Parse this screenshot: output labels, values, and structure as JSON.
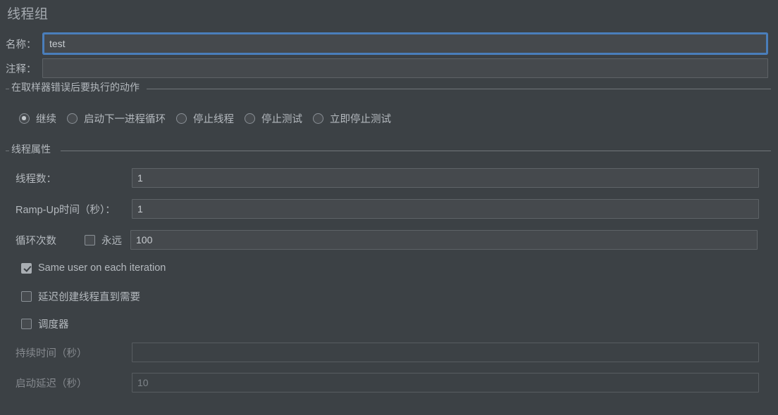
{
  "panel": {
    "title": "线程组"
  },
  "name_field": {
    "label": "名称：",
    "value": "test",
    "placeholder": ""
  },
  "comment_field": {
    "label": "注释：",
    "value": "",
    "placeholder": ""
  },
  "error_action_group": {
    "title": "在取样器错误后要执行的动作",
    "selected": "继续",
    "options": [
      {
        "label": "继续",
        "checked": true
      },
      {
        "label": "启动下一进程循环",
        "checked": false
      },
      {
        "label": "停止线程",
        "checked": false
      },
      {
        "label": "停止测试",
        "checked": false
      },
      {
        "label": "立即停止测试",
        "checked": false
      }
    ]
  },
  "thread_properties": {
    "title": "线程属性",
    "num_threads": {
      "label": "线程数：",
      "value": "1"
    },
    "ramp_up": {
      "label": "Ramp-Up时间（秒）：",
      "value": "1"
    },
    "loop_count": {
      "label": "循环次数",
      "forever_label": "永远",
      "forever_checked": false,
      "value": "100"
    },
    "same_user": {
      "label": "Same user on each iteration",
      "checked": true
    },
    "delay_thread_creation": {
      "label": "延迟创建线程直到需要",
      "checked": false
    },
    "scheduler": {
      "label": "调度器",
      "checked": false
    },
    "duration": {
      "label": "持续时间（秒）",
      "value": "",
      "enabled": false
    },
    "startup_delay": {
      "label": "启动延迟（秒）",
      "value": "10",
      "enabled": false
    }
  },
  "colors": {
    "background": "#3c4145",
    "field_background": "#45494d",
    "focus_ring": "#4a7ebb",
    "text": "#b4b9be",
    "border": "#5e6367"
  }
}
